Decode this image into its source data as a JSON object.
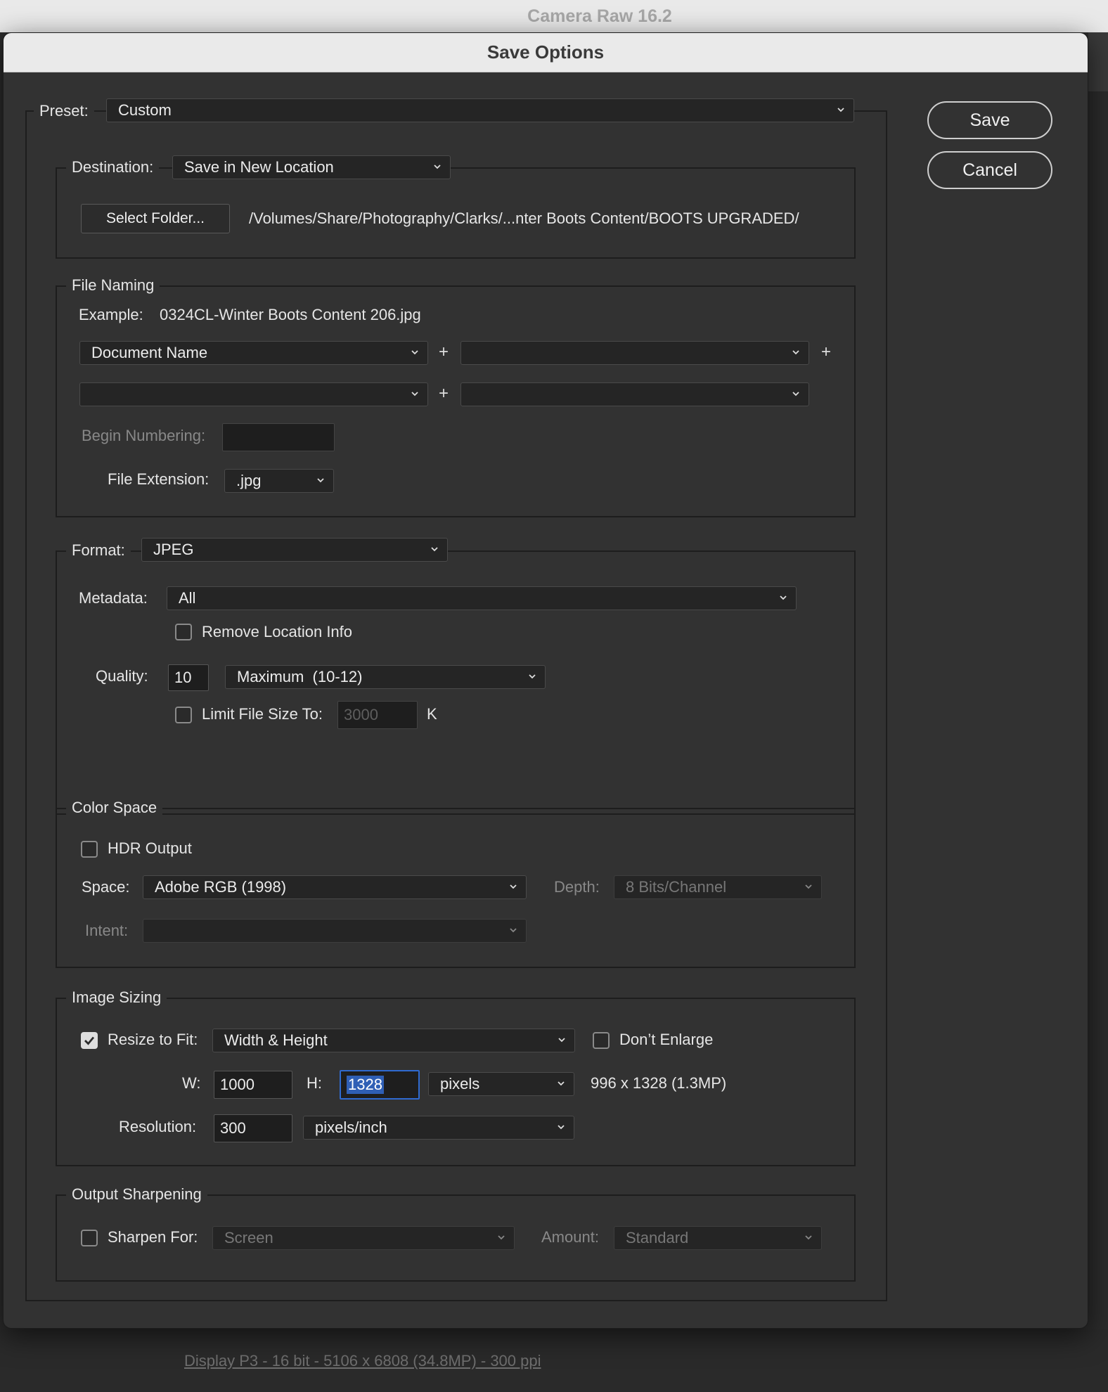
{
  "app": {
    "title": "Camera Raw 16.2",
    "status_link": "Display P3 - 16 bit - 5106 x 6808 (34.8MP) - 300 ppi"
  },
  "dialog": {
    "title": "Save Options",
    "save_label": "Save",
    "cancel_label": "Cancel"
  },
  "preset": {
    "label": "Preset:",
    "value": "Custom"
  },
  "destination": {
    "label": "Destination:",
    "value": "Save in New Location",
    "select_folder_label": "Select Folder...",
    "path": "/Volumes/Share/Photography/Clarks/...nter Boots Content/BOOTS UPGRADED/"
  },
  "file_naming": {
    "title": "File Naming",
    "example_label": "Example:",
    "example_value": "0324CL-Winter Boots Content 206.jpg",
    "name_part_1": "Document Name",
    "name_part_2": "",
    "name_part_3": "",
    "name_part_4": "",
    "plus": "+",
    "begin_numbering_label": "Begin Numbering:",
    "begin_numbering_value": "",
    "extension_label": "File Extension:",
    "extension_value": ".jpg"
  },
  "format": {
    "label": "Format:",
    "value": "JPEG",
    "metadata_label": "Metadata:",
    "metadata_value": "All",
    "remove_location_label": "Remove Location Info",
    "remove_location_checked": false,
    "quality_label": "Quality:",
    "quality_value": "10",
    "quality_preset": "Maximum  (10-12)",
    "limit_label": "Limit File Size To:",
    "limit_checked": false,
    "limit_value": "3000",
    "limit_unit": "K"
  },
  "color_space": {
    "title": "Color Space",
    "hdr_label": "HDR Output",
    "hdr_checked": false,
    "space_label": "Space:",
    "space_value": "Adobe RGB (1998)",
    "depth_label": "Depth:",
    "depth_value": "8 Bits/Channel",
    "intent_label": "Intent:",
    "intent_value": ""
  },
  "image_sizing": {
    "title": "Image Sizing",
    "resize_label": "Resize to Fit:",
    "resize_checked": true,
    "resize_value": "Width & Height",
    "dont_enlarge_label": "Don’t Enlarge",
    "dont_enlarge_checked": false,
    "w_label": "W:",
    "w_value": "1000",
    "h_label": "H:",
    "h_value": "1328",
    "unit_value": "pixels",
    "result_text": "996 x 1328 (1.3MP)",
    "resolution_label": "Resolution:",
    "resolution_value": "300",
    "resolution_unit": "pixels/inch"
  },
  "output_sharpening": {
    "title": "Output Sharpening",
    "sharpen_label": "Sharpen For:",
    "sharpen_checked": false,
    "sharpen_value": "Screen",
    "amount_label": "Amount:",
    "amount_value": "Standard"
  },
  "colors": {
    "dialog_bg": "#323232",
    "focus_blue": "#2f6ad0",
    "selection_blue": "#2f5fb5"
  }
}
